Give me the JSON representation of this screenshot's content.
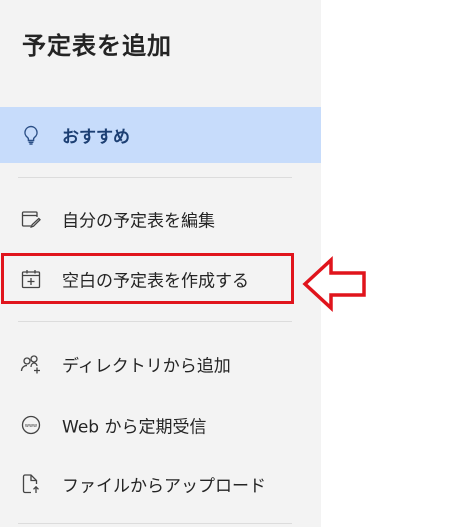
{
  "panel": {
    "title": "予定表を追加"
  },
  "items": [
    {
      "label": "おすすめ",
      "icon": "lightbulb-icon",
      "selected": true
    },
    {
      "label": "自分の予定表を編集",
      "icon": "edit-calendar-icon"
    },
    {
      "label": "空白の予定表を作成する",
      "icon": "calendar-add-icon"
    },
    {
      "label": "ディレクトリから追加",
      "icon": "people-add-icon"
    },
    {
      "label": "Web から定期受信",
      "icon": "web-subscribe-icon"
    },
    {
      "label": "ファイルからアップロード",
      "icon": "file-upload-icon"
    }
  ],
  "colors": {
    "selected_bg": "#c7dcfb",
    "sidebar_bg": "#f3f3f3",
    "annotation_red": "#e0141c"
  },
  "annotation": {
    "icon": "left-arrow-icon"
  }
}
